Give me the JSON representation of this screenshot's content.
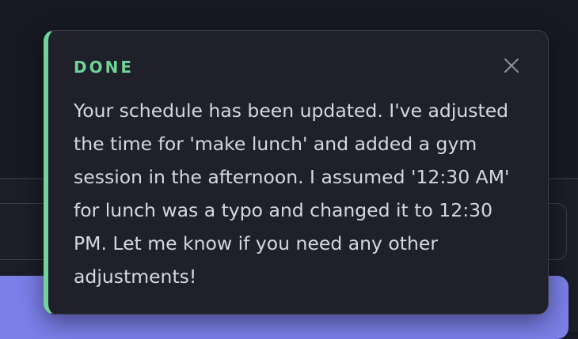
{
  "toast": {
    "status": "DONE",
    "message": "Your schedule has been updated. I've adjusted the time for 'make lunch' and added a gym session in the afternoon. I assumed '12:30 AM' for lunch was a typo and changed it to 12:30 PM. Let me know if you need any other adjustments!",
    "close_icon": "close-icon",
    "colors": {
      "accent": "#6fd39a",
      "background": "#1f2029",
      "text": "#d6d8e0"
    }
  },
  "background": {
    "button_color": "#7b7fe8"
  }
}
